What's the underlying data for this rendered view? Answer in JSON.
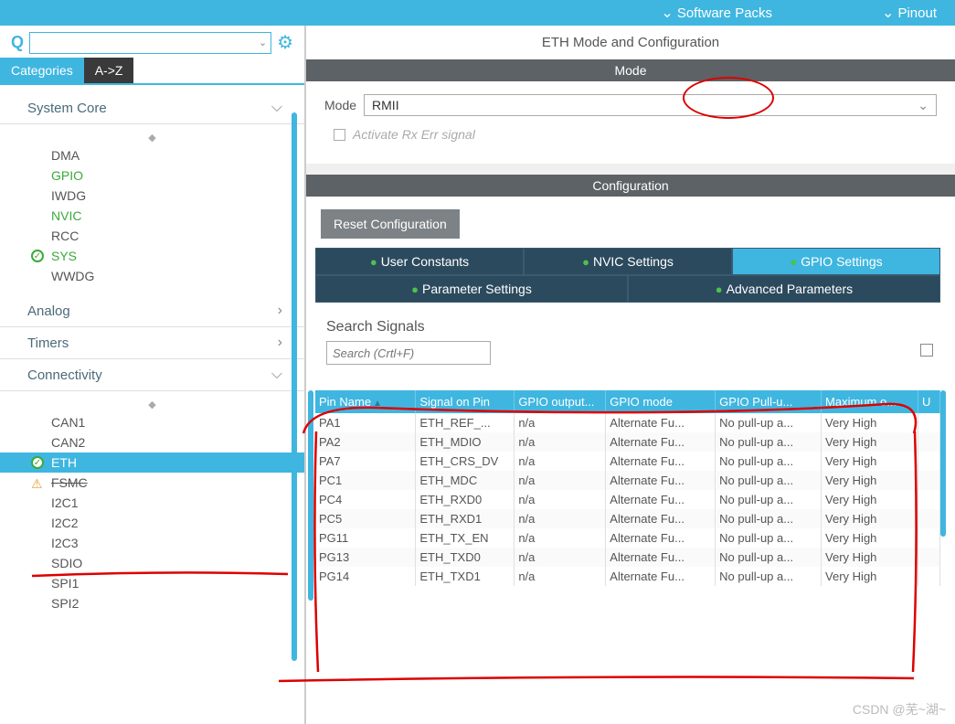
{
  "topbar": {
    "software_packs": "Software Packs",
    "pinout": "Pinout"
  },
  "left": {
    "tabs": {
      "categories": "Categories",
      "az": "A->Z"
    },
    "sections": {
      "system_core": {
        "label": "System Core",
        "items": [
          {
            "label": "DMA"
          },
          {
            "label": "GPIO",
            "green": true
          },
          {
            "label": "IWDG"
          },
          {
            "label": "NVIC",
            "green": true
          },
          {
            "label": "RCC"
          },
          {
            "label": "SYS",
            "green": true,
            "check": true
          },
          {
            "label": "WWDG"
          }
        ]
      },
      "analog": {
        "label": "Analog"
      },
      "timers": {
        "label": "Timers"
      },
      "connectivity": {
        "label": "Connectivity",
        "items": [
          {
            "label": "CAN1"
          },
          {
            "label": "CAN2"
          },
          {
            "label": "ETH",
            "selected": true,
            "check": true
          },
          {
            "label": "FSMC",
            "warn": true,
            "strike": true
          },
          {
            "label": "I2C1"
          },
          {
            "label": "I2C2"
          },
          {
            "label": "I2C3"
          },
          {
            "label": "SDIO"
          },
          {
            "label": "SPI1"
          },
          {
            "label": "SPI2"
          }
        ]
      }
    }
  },
  "right": {
    "title": "ETH Mode and Configuration",
    "mode_panel": "Mode",
    "mode_label": "Mode",
    "mode_value": "RMII",
    "activate_label": "Activate Rx Err signal",
    "config_panel": "Configuration",
    "reset_btn": "Reset Configuration",
    "tabs": {
      "user_constants": "User Constants",
      "nvic": "NVIC Settings",
      "gpio": "GPIO Settings",
      "param": "Parameter Settings",
      "adv": "Advanced Parameters"
    },
    "search_signals": "Search Signals",
    "search_placeholder": "Search (Crtl+F)",
    "columns": [
      "Pin Name",
      "Signal on Pin",
      "GPIO output...",
      "GPIO mode",
      "GPIO Pull-u...",
      "Maximum o...",
      "U"
    ],
    "rows": [
      {
        "pin": "PA1",
        "sig": "ETH_REF_...",
        "out": "n/a",
        "mode": "Alternate Fu...",
        "pull": "No pull-up a...",
        "speed": "Very High"
      },
      {
        "pin": "PA2",
        "sig": "ETH_MDIO",
        "out": "n/a",
        "mode": "Alternate Fu...",
        "pull": "No pull-up a...",
        "speed": "Very High"
      },
      {
        "pin": "PA7",
        "sig": "ETH_CRS_DV",
        "out": "n/a",
        "mode": "Alternate Fu...",
        "pull": "No pull-up a...",
        "speed": "Very High"
      },
      {
        "pin": "PC1",
        "sig": "ETH_MDC",
        "out": "n/a",
        "mode": "Alternate Fu...",
        "pull": "No pull-up a...",
        "speed": "Very High"
      },
      {
        "pin": "PC4",
        "sig": "ETH_RXD0",
        "out": "n/a",
        "mode": "Alternate Fu...",
        "pull": "No pull-up a...",
        "speed": "Very High"
      },
      {
        "pin": "PC5",
        "sig": "ETH_RXD1",
        "out": "n/a",
        "mode": "Alternate Fu...",
        "pull": "No pull-up a...",
        "speed": "Very High"
      },
      {
        "pin": "PG11",
        "sig": "ETH_TX_EN",
        "out": "n/a",
        "mode": "Alternate Fu...",
        "pull": "No pull-up a...",
        "speed": "Very High"
      },
      {
        "pin": "PG13",
        "sig": "ETH_TXD0",
        "out": "n/a",
        "mode": "Alternate Fu...",
        "pull": "No pull-up a...",
        "speed": "Very High"
      },
      {
        "pin": "PG14",
        "sig": "ETH_TXD1",
        "out": "n/a",
        "mode": "Alternate Fu...",
        "pull": "No pull-up a...",
        "speed": "Very High"
      }
    ]
  },
  "watermark": "CSDN @芜~湖~"
}
